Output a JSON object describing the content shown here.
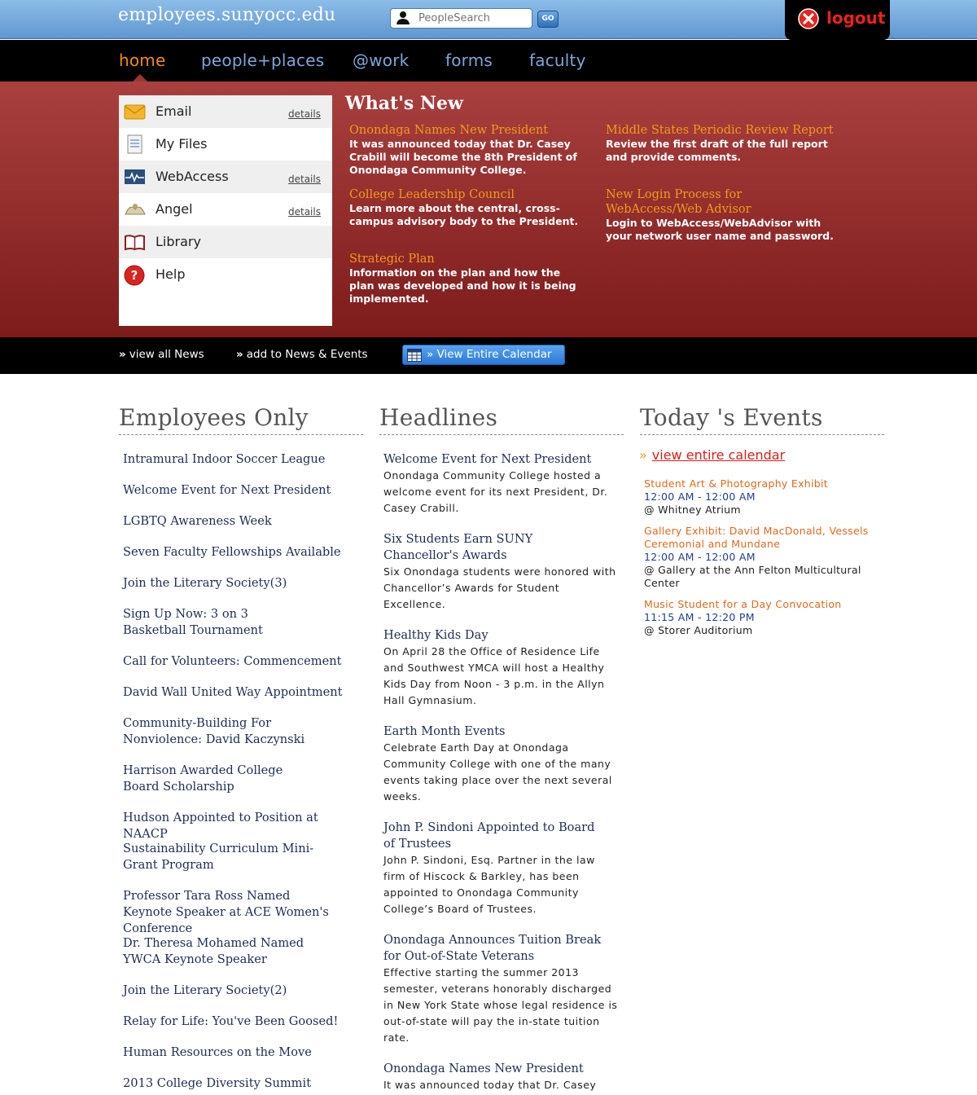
{
  "header": {
    "site_title": "employees.sunyocc.edu",
    "search_placeholder": "PeopleSearch",
    "go_label": "GO",
    "logout_label": "logout"
  },
  "nav": {
    "items": [
      {
        "label": "home",
        "active": true
      },
      {
        "label": "people+places",
        "active": false
      },
      {
        "label": "@work",
        "active": false
      },
      {
        "label": "forms",
        "active": false
      },
      {
        "label": "faculty",
        "active": false
      }
    ]
  },
  "quicklinks": [
    {
      "label": "Email",
      "details": "details",
      "icon": "envelope-icon"
    },
    {
      "label": "My Files",
      "details": "",
      "icon": "file-icon"
    },
    {
      "label": "WebAccess",
      "details": "details",
      "icon": "pulse-monitor-icon"
    },
    {
      "label": "Angel",
      "details": "details",
      "icon": "angel-icon"
    },
    {
      "label": "Library",
      "details": "",
      "icon": "book-icon"
    },
    {
      "label": "Help",
      "details": "",
      "icon": "help-icon"
    }
  ],
  "whats_new": {
    "title": "What's New",
    "items": [
      {
        "heading": "Onondaga Names New President",
        "body": "It was announced today that Dr. Casey Crabill will become the 8th President of Onondaga Community College."
      },
      {
        "heading": "College Leadership Council",
        "body": "Learn more about the central, cross-campus advisory body to the President."
      },
      {
        "heading": "Strategic Plan",
        "body": "Information on the plan and how the plan was developed and how it is being implemented."
      },
      {
        "heading": "Middle States Periodic Review Report",
        "body": "Review the first draft of the full report and provide comments."
      },
      {
        "heading": "New Login Process for WebAccess/Web Advisor",
        "body": "Login to WebAccess/WebAdvisor with your network user name and password."
      }
    ]
  },
  "bottom_bar": {
    "view_all_news": "view all News",
    "add_news": "add to News & Events",
    "view_calendar": "View Entire Calendar",
    "arrow": "»"
  },
  "employees_only": {
    "title": "Employees Only",
    "items": [
      "Intramural Indoor Soccer League",
      "Welcome Event for Next President",
      "LGBTQ Awareness Week",
      "Seven Faculty Fellowships Available",
      "Join the Literary Society(3)",
      "Sign Up Now: 3 on 3 Basketball Tournament",
      "Call for Volunteers: Commencement",
      "David Wall United Way Appointment",
      "Community-Building For Nonviolence: David Kaczynski",
      "Harrison Awarded College Board Scholarship",
      "Hudson Appointed to Position at NAACP",
      "Sustainability Curriculum Mini-Grant Program",
      "Professor Tara Ross Named Keynote Speaker at ACE Women's Conference",
      "Dr. Theresa Mohamed Named YWCA Keynote Speaker",
      "Join the Literary Society(2)",
      "Relay for Life: You've Been Goosed!",
      "Human Resources on the Move",
      "2013 College Diversity Summit"
    ]
  },
  "headlines": {
    "title": "Headlines",
    "items": [
      {
        "title": "Welcome Event for Next President",
        "desc": "Onondaga Community College hosted a welcome event for its next President, Dr. Casey Crabill."
      },
      {
        "title": "Six Students Earn SUNY Chancellor's Awards",
        "desc": "Six Onondaga students were honored with Chancellor’s Awards for Student Excellence."
      },
      {
        "title": "Healthy Kids Day",
        "desc": "On April 28 the Office of Residence Life and Southwest YMCA will host a Healthy Kids Day from Noon - 3 p.m. in the Allyn Hall Gymnasium."
      },
      {
        "title": "Earth Month Events",
        "desc": "Celebrate Earth Day at Onondaga Community College with one of the many events taking place over the next several weeks."
      },
      {
        "title": "John P. Sindoni Appointed to Board of Trustees",
        "desc": "John P. Sindoni, Esq. Partner in the law firm of Hiscock & Barkley, has been appointed to Onondaga Community College’s Board of Trustees."
      },
      {
        "title": "Onondaga Announces Tuition Break for Out-of-State Veterans",
        "desc": "Effective starting the summer 2013 semester, veterans honorably discharged in New York State whose legal residence is out-of-state will pay the in-state tuition rate."
      },
      {
        "title": "Onondaga Names New President",
        "desc": "It was announced today that Dr. Casey"
      }
    ]
  },
  "events": {
    "title": "Today 's Events",
    "view_calendar": "view entire calendar",
    "items": [
      {
        "name": "Student Art & Photography Exhibit",
        "time": "12:00 AM - 12:00 AM",
        "location": "@ Whitney Atrium"
      },
      {
        "name": "Gallery Exhibit: David MacDonald, Vessels Ceremonial and Mundane",
        "time": "12:00 AM - 12:00 AM",
        "location": "@ Gallery at the Ann Felton Multicultural Center"
      },
      {
        "name": "Music Student for a Day Convocation",
        "time": "11:15 AM - 12:20 PM",
        "location": "@ Storer Auditorium"
      }
    ]
  },
  "colors": {
    "nav_active": "#f08a1c",
    "hero_red": "#8f2c2b",
    "accent_orange": "#f29b1e",
    "link_red": "#d9201b"
  }
}
